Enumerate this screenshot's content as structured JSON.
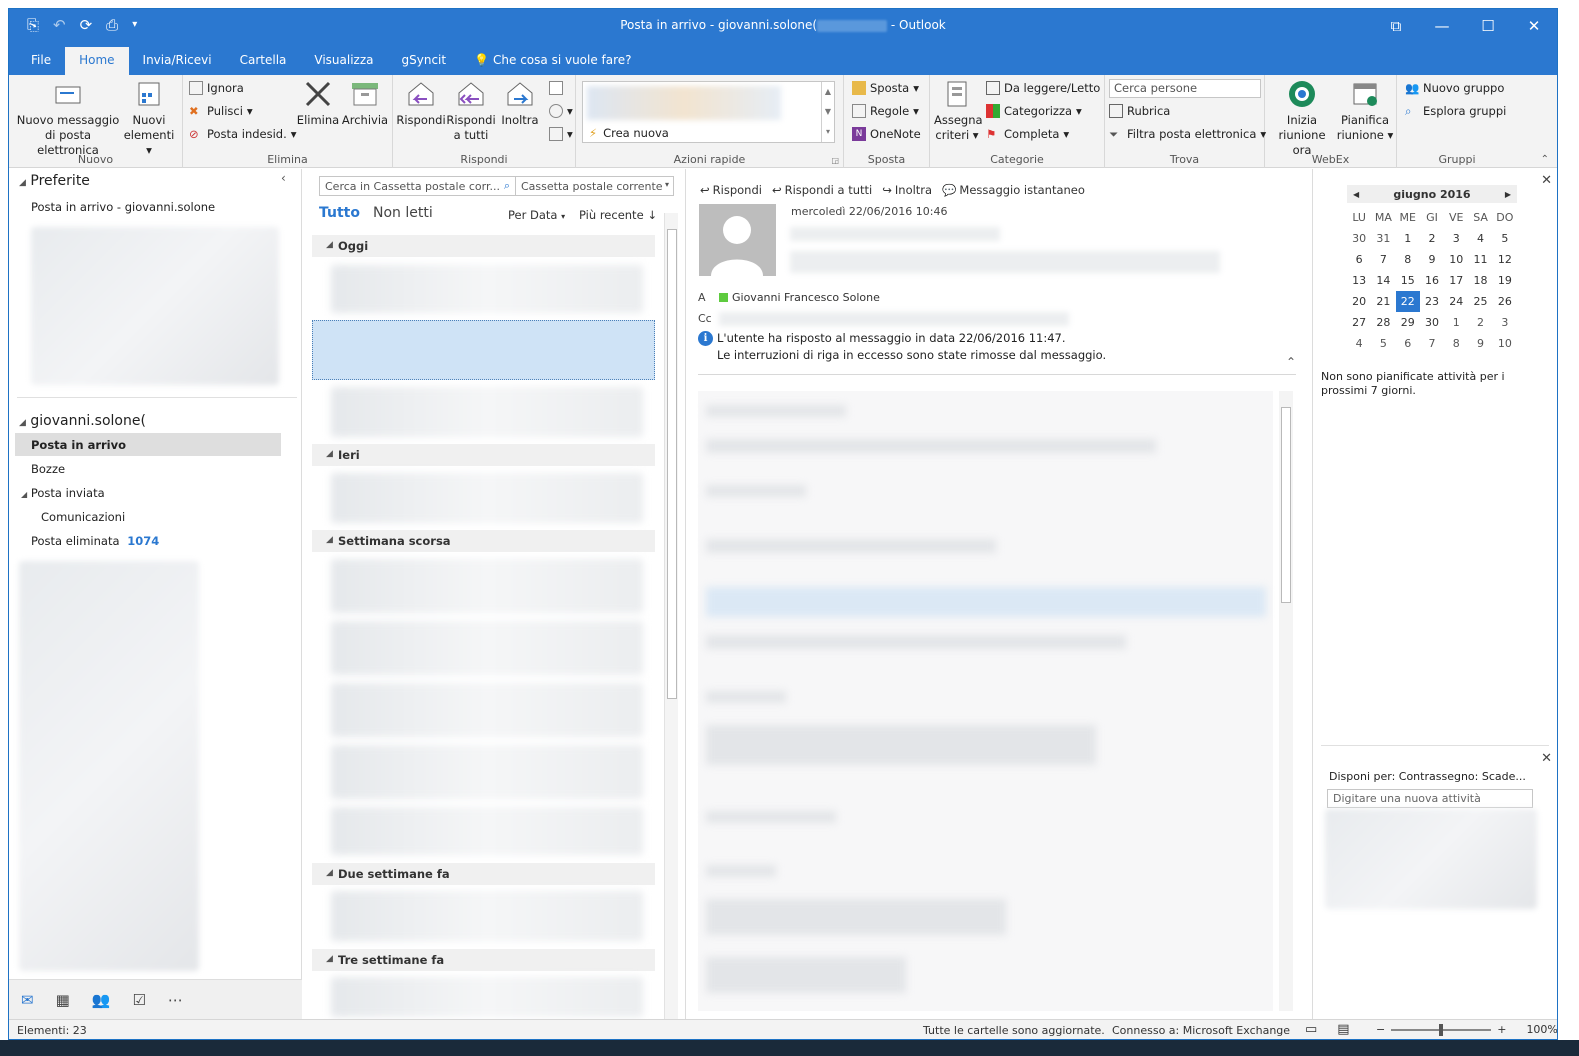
{
  "window": {
    "title": "Posta in arrivo - giovanni.solone(",
    "title_suffix": " - Outlook"
  },
  "tabs": [
    {
      "label": "File"
    },
    {
      "label": "Home"
    },
    {
      "label": "Invia/Ricevi"
    },
    {
      "label": "Cartella"
    },
    {
      "label": "Visualizza"
    },
    {
      "label": "gSyncit"
    },
    {
      "label": "Che cosa si vuole fare?"
    }
  ],
  "ribbon": {
    "nuovo": {
      "label": "Nuovo",
      "new_email_1": "Nuovo messaggio",
      "new_email_2": "di posta elettronica",
      "new_items_1": "Nuovi",
      "new_items_2": "elementi"
    },
    "elimina": {
      "label": "Elimina",
      "ignora": "Ignora",
      "pulisci": "Pulisci",
      "posta_indesid": "Posta indesid.",
      "elimina": "Elimina",
      "archivia": "Archivia"
    },
    "rispondi": {
      "label": "Rispondi",
      "rispondi": "Rispondi",
      "rispondi_tutti_1": "Rispondi",
      "rispondi_tutti_2": "a tutti",
      "inoltra": "Inoltra"
    },
    "azioni_rapide": {
      "label": "Azioni rapide",
      "crea_nuova": "Crea nuova"
    },
    "sposta": {
      "label": "Sposta",
      "sposta": "Sposta",
      "regole": "Regole",
      "onenote": "OneNote"
    },
    "categorie": {
      "label": "Categorie",
      "assegna_1": "Assegna",
      "assegna_2": "criteri",
      "da_leggere": "Da leggere/Letto",
      "categorizza": "Categorizza",
      "completa": "Completa"
    },
    "trova": {
      "label": "Trova",
      "cerca_persone": "Cerca persone",
      "rubrica": "Rubrica",
      "filtra": "Filtra posta elettronica"
    },
    "webex": {
      "label": "WebEx",
      "inizia_1": "Inizia",
      "inizia_2": "riunione ora",
      "pianifica_1": "Pianifica",
      "pianifica_2": "riunione"
    },
    "gruppi": {
      "label": "Gruppi",
      "nuovo_gruppo": "Nuovo gruppo",
      "esplora_gruppi": "Esplora gruppi"
    }
  },
  "nav": {
    "preferite": "Preferite",
    "fav_inbox": "Posta in arrivo - giovanni.solone",
    "account": "giovanni.solone(",
    "folders": {
      "inbox": "Posta in arrivo",
      "drafts": "Bozze",
      "sent": "Posta inviata",
      "comms": "Comunicazioni",
      "deleted": "Posta eliminata",
      "deleted_count": "1074"
    }
  },
  "list": {
    "search_placeholder": "Cerca in Cassetta postale corr...",
    "scope": "Cassetta postale corrente",
    "filter_all": "Tutto",
    "filter_unread": "Non letti",
    "sort_by": "Per Data",
    "order": "Più recente",
    "groups": {
      "today": "Oggi",
      "yesterday": "Ieri",
      "last_week": "Settimana scorsa",
      "two_weeks": "Due settimane fa",
      "three_weeks": "Tre settimane fa"
    }
  },
  "reading": {
    "actions": {
      "reply": "Rispondi",
      "reply_all": "Rispondi a tutti",
      "forward": "Inoltra",
      "im": "Messaggio istantaneo"
    },
    "date": "mercoledì 22/06/2016 10:46",
    "to_label": "A",
    "cc_label": "Cc",
    "to_name": "Giovanni Francesco Solone",
    "info_line1": "L'utente ha risposto al messaggio in data 22/06/2016 11:47.",
    "info_line2": "Le interruzioni di riga in eccesso sono state rimosse dal messaggio."
  },
  "todo": {
    "calendar": {
      "month": "giugno 2016",
      "weekdays": [
        "LU",
        "MA",
        "ME",
        "GI",
        "VE",
        "SA",
        "DO"
      ],
      "weeks": [
        [
          "30",
          "31",
          "1",
          "2",
          "3",
          "4",
          "5"
        ],
        [
          "6",
          "7",
          "8",
          "9",
          "10",
          "11",
          "12"
        ],
        [
          "13",
          "14",
          "15",
          "16",
          "17",
          "18",
          "19"
        ],
        [
          "20",
          "21",
          "22",
          "23",
          "24",
          "25",
          "26"
        ],
        [
          "27",
          "28",
          "29",
          "30",
          "1",
          "2",
          "3"
        ],
        [
          "4",
          "5",
          "6",
          "7",
          "8",
          "9",
          "10"
        ]
      ],
      "today": "22"
    },
    "no_activities": "Non sono pianificate attività per i prossimi 7 giorni.",
    "tasks_arrange": "Disponi per: Contrassegno: Scade...",
    "new_task_placeholder": "Digitare una nuova attività"
  },
  "status": {
    "items": "Elementi: 23",
    "sync": "Tutte le cartelle sono aggiornate.",
    "connection": "Connesso a: Microsoft Exchange",
    "zoom": "100%"
  },
  "colors": {
    "accent": "#2b78d0",
    "selection": "#cfe3f6"
  }
}
